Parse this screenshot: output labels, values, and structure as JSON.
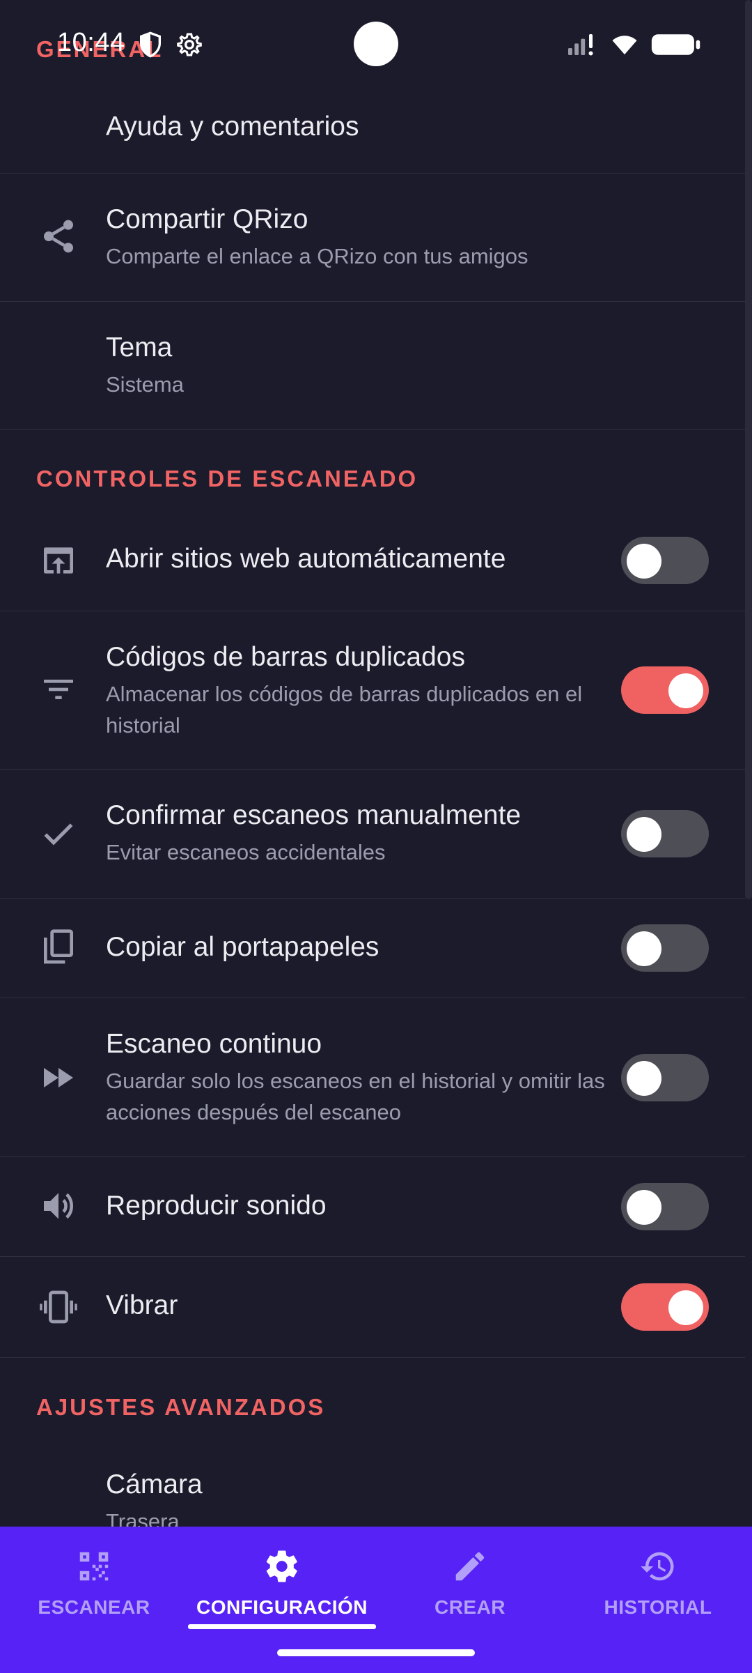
{
  "status_bar": {
    "time": "10:44"
  },
  "sections": {
    "general": "GENERAL",
    "scan_controls": "CONTROLES DE ESCANEADO",
    "advanced": "AJUSTES AVANZADOS"
  },
  "general_items": {
    "help": {
      "title": "Ayuda y comentarios"
    },
    "share": {
      "title": "Compartir QRizo",
      "subtitle": "Comparte el enlace a QRizo con tus amigos",
      "icon": "share-icon"
    },
    "theme": {
      "title": "Tema",
      "subtitle": "Sistema"
    }
  },
  "scan_items": {
    "open_websites": {
      "title": "Abrir sitios web automáticamente",
      "icon": "open-in-browser-icon",
      "enabled": false
    },
    "duplicates": {
      "title": "Códigos de barras duplicados",
      "subtitle": "Almacenar los códigos de barras duplicados en el historial",
      "icon": "filter-icon",
      "enabled": true
    },
    "confirm": {
      "title": "Confirmar escaneos manualmente",
      "subtitle": "Evitar escaneos accidentales",
      "icon": "check-icon",
      "enabled": false
    },
    "copy": {
      "title": "Copiar al portapapeles",
      "icon": "copy-icon",
      "enabled": false
    },
    "continuous": {
      "title": "Escaneo continuo",
      "subtitle": "Guardar solo los escaneos en el historial y omitir las acciones después del escaneo",
      "icon": "fast-forward-icon",
      "enabled": false
    },
    "sound": {
      "title": "Reproducir sonido",
      "icon": "volume-icon",
      "enabled": false
    },
    "vibrate": {
      "title": "Vibrar",
      "icon": "vibrate-icon",
      "enabled": true
    }
  },
  "advanced_items": {
    "camera": {
      "title": "Cámara",
      "subtitle": "Trasera"
    }
  },
  "bottom_nav": {
    "scan": "ESCANEAR",
    "settings": "CONFIGURACIÓN",
    "create": "CREAR",
    "history": "HISTORIAL",
    "active": "settings"
  },
  "colors": {
    "background": "#1b1b2c",
    "accent": "#f26464",
    "nav_background": "#5722f5",
    "toggle_off": "#4e4e56"
  }
}
